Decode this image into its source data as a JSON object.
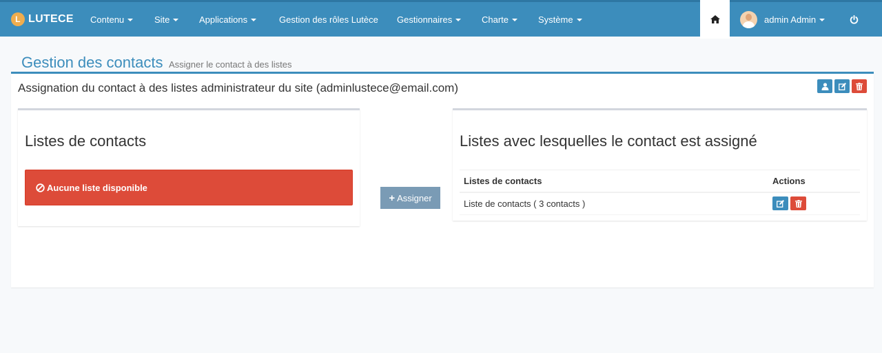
{
  "navbar": {
    "brand_letter": "L",
    "brand": "LUTECE",
    "items": [
      {
        "label": "Contenu",
        "dropdown": true
      },
      {
        "label": "Site",
        "dropdown": true
      },
      {
        "label": "Applications",
        "dropdown": true
      },
      {
        "label": "Gestion des rôles Lutèce",
        "dropdown": false
      },
      {
        "label": "Gestionnaires",
        "dropdown": true
      },
      {
        "label": "Charte",
        "dropdown": true
      },
      {
        "label": "Système",
        "dropdown": true
      }
    ],
    "home_icon": "home-icon",
    "user": "admin Admin",
    "power_icon": "power-icon"
  },
  "page": {
    "title": "Gestion des contacts",
    "subtitle": "Assigner le contact à des listes"
  },
  "box": {
    "title": "Assignation du contact à des listes administrateur du site (adminlustece@email.com)"
  },
  "left_panel": {
    "title": "Listes de contacts",
    "alert": "Aucune liste disponible"
  },
  "assign_button": "Assigner",
  "right_panel": {
    "title": "Listes avec lesquelles le contact est assigné",
    "columns": [
      "Listes de contacts",
      "Actions"
    ],
    "rows": [
      {
        "name": "Liste de contacts ( 3 contacts )"
      }
    ]
  },
  "colors": {
    "primary": "#3c8dbc",
    "danger": "#dd4b39",
    "assign": "#7a9bb5",
    "background": "#f7f9fb"
  }
}
